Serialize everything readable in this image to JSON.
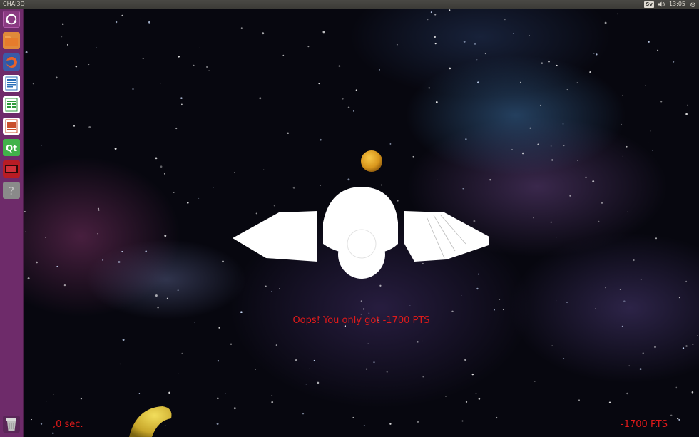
{
  "window": {
    "title": "CHAI3D"
  },
  "tray": {
    "keyboard_label": "Sv",
    "time": "13:05"
  },
  "launcher": {
    "items": [
      {
        "name": "dash-icon",
        "color": "#7a2a72"
      },
      {
        "name": "files-icon",
        "color": "#e07a2a"
      },
      {
        "name": "firefox-icon",
        "color": "#d2522c"
      },
      {
        "name": "writer-icon",
        "color": "#2a6fb8"
      },
      {
        "name": "calc-icon",
        "color": "#2f9a3c"
      },
      {
        "name": "impress-icon",
        "color": "#c9502c"
      },
      {
        "name": "qt-icon",
        "color": "#41b24a"
      },
      {
        "name": "media-app-icon",
        "color": "#c0202a"
      },
      {
        "name": "help-icon",
        "color": "#9a9a9a"
      }
    ],
    "trash": {
      "name": "trash-icon"
    }
  },
  "game": {
    "message": "Oops! You only got -1700 PTS",
    "time_label": ",0 sec.",
    "score_label": "-1700 PTS",
    "text_color": "#e01a1a"
  }
}
